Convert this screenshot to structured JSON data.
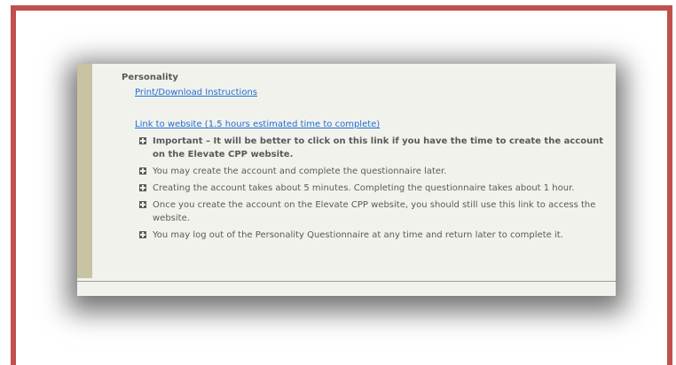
{
  "section": {
    "heading": "Personality",
    "print_link": "Print/Download Instructions",
    "website_link": "Link to website (1.5 hours estimated time to complete)"
  },
  "items": [
    "Important – It will be better to click on this link if you have the time to create the account on the Elevate CPP website.",
    "You may create the account and complete the questionnaire later.",
    "Creating the account takes about 5 minutes. Completing the questionnaire takes about 1 hour.",
    "Once you create the account on the Elevate CPP website, you should still use this link to access the website.",
    "You may log out of the Personality Questionnaire at any time and return later to complete it."
  ],
  "icons": {
    "bullet": "expand-plus-icon"
  },
  "colors": {
    "frame_border": "#c0504d",
    "panel_background": "#f2f2ed",
    "side_bar": "#c8c3a3",
    "link": "#1f6fd1",
    "text": "#595959"
  }
}
